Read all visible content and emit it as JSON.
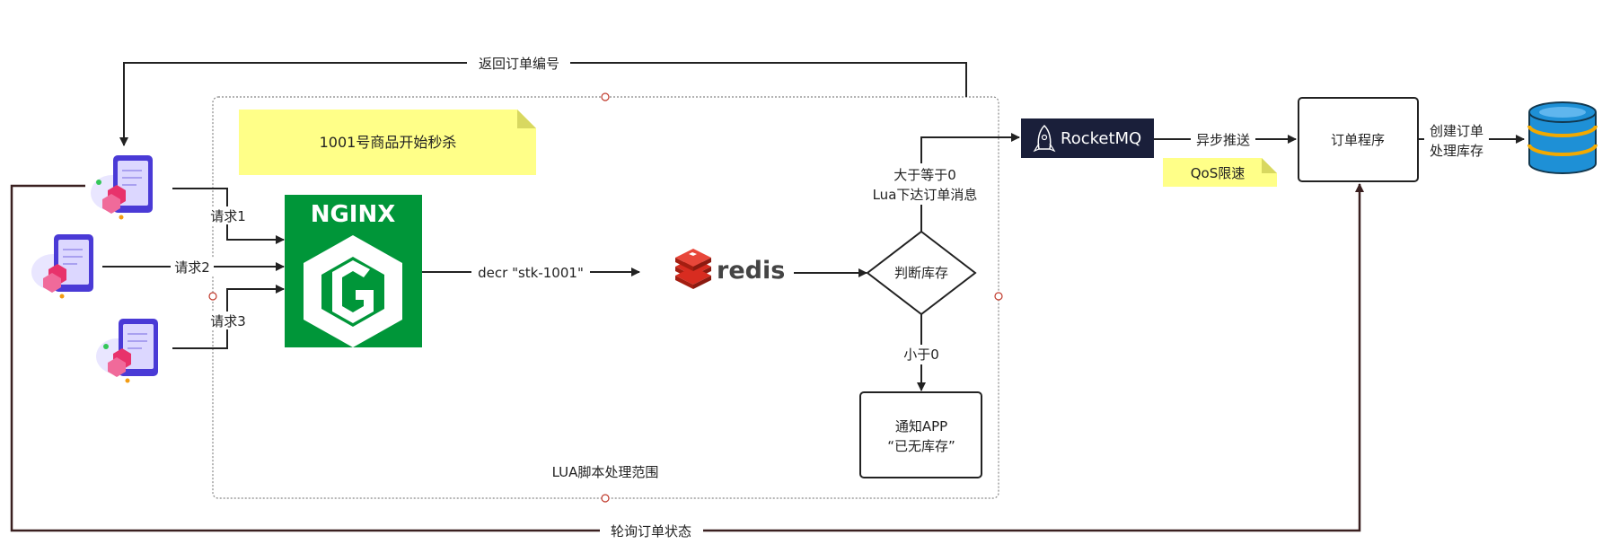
{
  "labels": {
    "return_order_no": "返回订单编号",
    "seckill_note": "1001号商品开始秒杀",
    "request1": "请求1",
    "request2": "请求2",
    "request3": "请求3",
    "nginx": "NGINX",
    "decr_cmd": "decr \"stk-1001\"",
    "redis": "redis",
    "judge_stock": "判断库存",
    "ge_zero_line1": "大于等于0",
    "ge_zero_line2": "Lua下达订单消息",
    "lt_zero": "小于0",
    "notify_line1": "通知APP",
    "notify_line2": "“已无库存”",
    "lua_scope": "LUA脚本处理范围",
    "rocketmq": "RocketMQ",
    "async_push": "异步推送",
    "qos_note": "QoS限速",
    "order_program": "订单程序",
    "create_order_line1": "创建订单",
    "create_order_line2": "处理库存",
    "poll_order_status": "轮询订单状态"
  },
  "icons": {
    "client": "mobile-phone-icon",
    "nginx": "nginx-logo",
    "redis": "redis-logo",
    "rocketmq": "rocket-icon",
    "database": "database-icon"
  },
  "colors": {
    "nginx_green": "#009639",
    "note_yellow": "#ffff88",
    "rocketmq_bg": "#1a1f3a",
    "redis_red": "#d82c20",
    "db_blue": "#1e90d6",
    "poll_line": "#3a2020"
  }
}
